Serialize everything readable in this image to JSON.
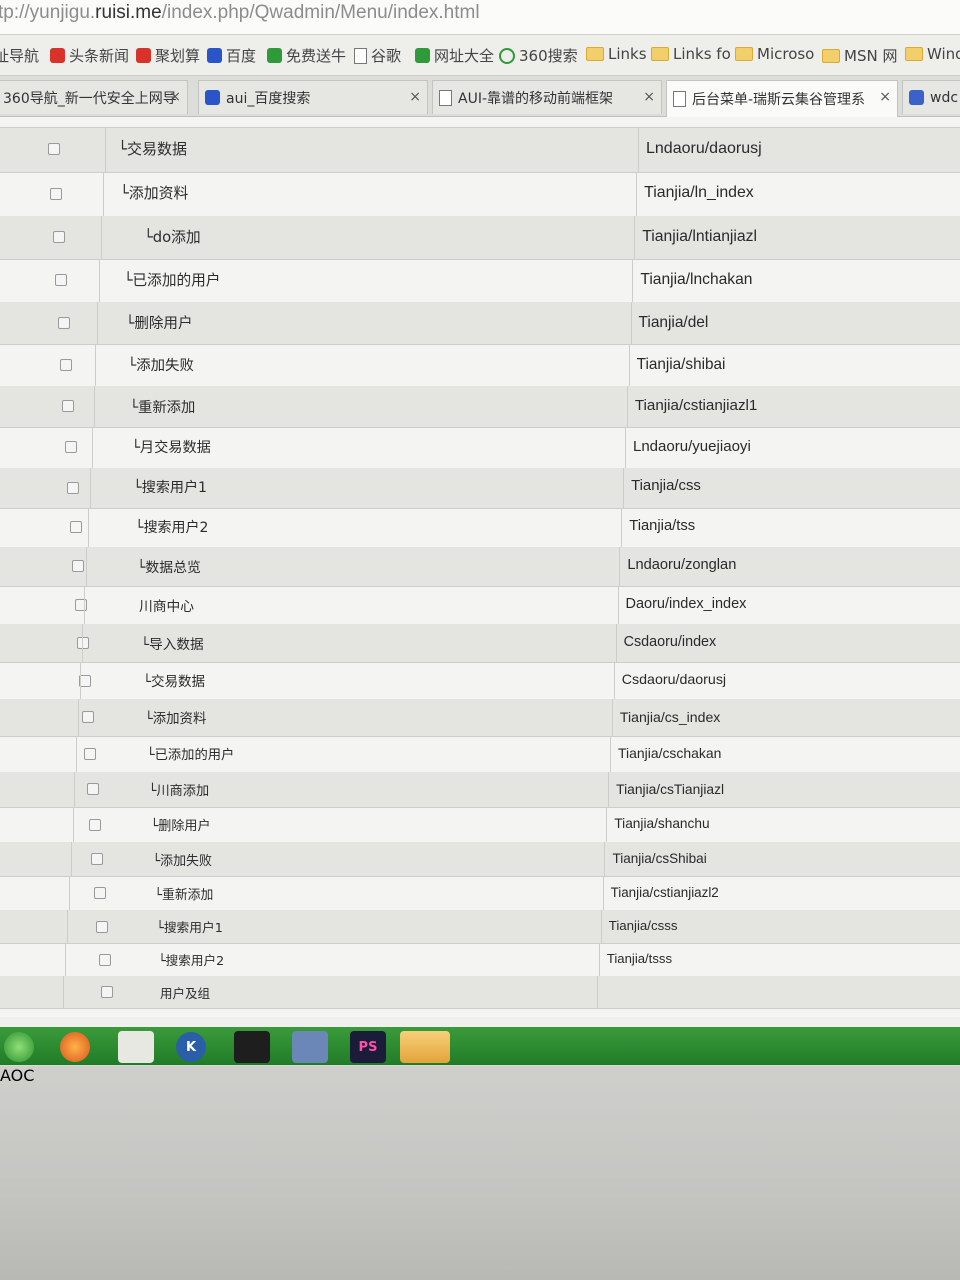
{
  "browser": {
    "url_prefix": "tp://yunjigu.",
    "url_domain": "ruisi.me",
    "url_path": "/index.php/Qwadmin/Menu/index.html",
    "bookmarks": [
      "址导航",
      "头条新闻",
      "聚划算",
      "百度",
      "免费送牛",
      "谷歌",
      "网址大全",
      "360搜索",
      "Links",
      "Links fo",
      "Microso",
      "MSN 网",
      "Windc"
    ],
    "tabs": [
      "360导航_新一代安全上网导",
      "aui_百度搜索",
      "AUI-靠谱的移动前端框架",
      "后台菜单-瑞斯云集谷管理系",
      "wdc"
    ],
    "close_glyph": "×"
  },
  "table": {
    "rows": [
      {
        "name": "└交易数据",
        "path": "Lndaoru/daorusj"
      },
      {
        "name": "└添加资料",
        "path": "Tianjia/ln_index"
      },
      {
        "name": "└do添加",
        "path": "Tianjia/lntianjiazl"
      },
      {
        "name": "└已添加的用户",
        "path": "Tianjia/lnchakan"
      },
      {
        "name": "└删除用户",
        "path": "Tianjia/del"
      },
      {
        "name": "└添加失败",
        "path": "Tianjia/shibai"
      },
      {
        "name": "└重新添加",
        "path": "Tianjia/cstianjiazl1"
      },
      {
        "name": "└月交易数据",
        "path": "Lndaoru/yuejiaoyi"
      },
      {
        "name": "└搜索用户1",
        "path": "Tianjia/css"
      },
      {
        "name": "└搜索用户2",
        "path": "Tianjia/tss"
      },
      {
        "name": "└数据总览",
        "path": "Lndaoru/zonglan"
      },
      {
        "name": "川商中心",
        "path": "Daoru/index_index"
      },
      {
        "name": "└导入数据",
        "path": "Csdaoru/index"
      },
      {
        "name": "└交易数据",
        "path": "Csdaoru/daorusj"
      },
      {
        "name": "└添加资料",
        "path": "Tianjia/cs_index"
      },
      {
        "name": "└已添加的用户",
        "path": "Tianjia/cschakan"
      },
      {
        "name": "└川商添加",
        "path": "Tianjia/csTianjiazl"
      },
      {
        "name": "└删除用户",
        "path": "Tianjia/shanchu"
      },
      {
        "name": "└添加失败",
        "path": "Tianjia/csShibai"
      },
      {
        "name": "└重新添加",
        "path": "Tianjia/cstianjiazl2"
      },
      {
        "name": "└搜索用户1",
        "path": "Tianjia/csss"
      },
      {
        "name": "└搜索用户2",
        "path": "Tianjia/tsss"
      },
      {
        "name": "用户及组",
        "path": ""
      }
    ]
  },
  "taskbar": {
    "icons": [
      "windows-start-icon",
      "firefox-icon",
      "activity-monitor-icon",
      "k-app-icon",
      "terminal-icon",
      "network-icon",
      "phpstorm-icon",
      "file-explorer-icon"
    ],
    "ps_label": "PS",
    "k_label": "K"
  },
  "monitor": {
    "brand": "AOC"
  }
}
